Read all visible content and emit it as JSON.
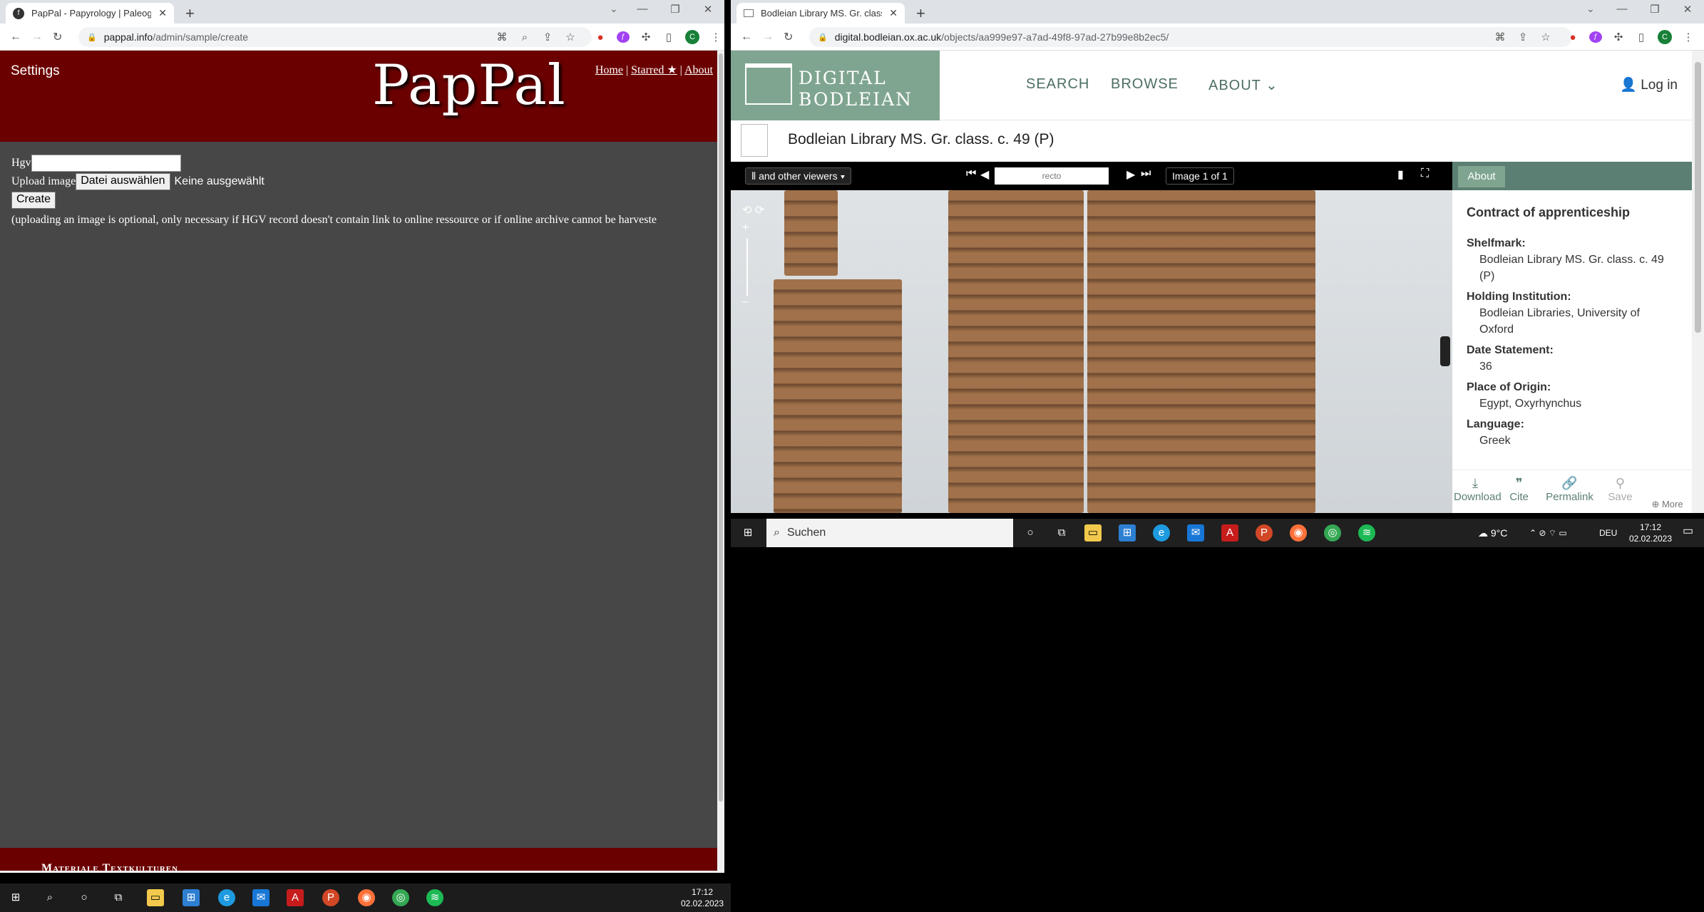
{
  "left_browser": {
    "tab_title": "PapPal - Papyrology | Paleograph",
    "new_tab_icon": "+",
    "url_domain": "pappal.info",
    "url_path": "/admin/sample/create",
    "site": {
      "settings_label": "Settings",
      "logo_text": "PapPal",
      "nav_home": "Home",
      "nav_starred": "Starred ★",
      "nav_about": "About",
      "sep": "|",
      "hgv_label": "Hgv",
      "upload_label": "Upload image",
      "choose_file_button": "Datei auswählen",
      "no_file_text": "Keine ausgewählt",
      "create_button": "Create",
      "note": "(uploading an image is optional, only necessary if HGV record doesn't contain link to online ressource or if online archive cannot be harveste",
      "footer_text": "Materiale Textkulturen"
    }
  },
  "right_browser": {
    "tab_title": "Bodleian Library MS. Gr. class. c.",
    "url_domain": "digital.bodleian.ox.ac.uk",
    "url_path": "/objects/aa999e97-a7ad-49f8-97ad-27b99e8b2ec5/",
    "site": {
      "logo_line1": "DIGITAL",
      "logo_line2": "BODLEIAN",
      "nav_search": "SEARCH",
      "nav_browse": "BROWSE",
      "nav_about": "ABOUT",
      "login": "Log in",
      "object_title": "Bodleian Library MS. Gr. class. c. 49 (P)",
      "viewer_dropdown": "and other viewers",
      "page_input_value": "recto",
      "image_counter": "Image 1 of 1",
      "about_tab": "About",
      "record_title": "Contract of apprenticeship",
      "fields": [
        {
          "label": "Shelfmark:",
          "value": "Bodleian Library MS. Gr. class. c. 49 (P)"
        },
        {
          "label": "Holding Institution:",
          "value": "Bodleian Libraries, University of Oxford"
        },
        {
          "label": "Date Statement:",
          "value": "36"
        },
        {
          "label": "Place of Origin:",
          "value": "Egypt, Oxyrhynchus"
        },
        {
          "label": "Language:",
          "value": "Greek"
        }
      ],
      "actions": [
        "Download",
        "Cite",
        "Permalink",
        "Save"
      ],
      "more": "More"
    }
  },
  "taskbar_left": {
    "time": "17:12",
    "date": "02.02.2023"
  },
  "taskbar_right": {
    "search_placeholder": "Suchen",
    "temperature": "9°C",
    "lang": "DEU",
    "time": "17:12",
    "date": "02.02.2023"
  },
  "colors": {
    "pappal_red": "#6b0000",
    "bodleian_green": "#7fa590",
    "pappal_bg": "#474747"
  }
}
